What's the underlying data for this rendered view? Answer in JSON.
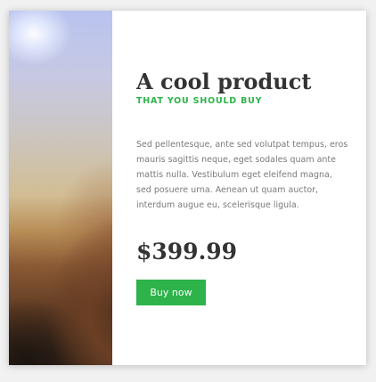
{
  "product": {
    "title": "A cool product",
    "tagline": "THAT YOU SHOULD BUY",
    "description": "Sed pellentesque, ante sed volutpat tempus, eros mauris sagittis neque, eget sodales quam ante mattis nulla. Vestibulum eget eleifend magna, sed posuere urna. Aenean ut quam auctor, interdum augue eu, scelerisque ligula.",
    "price": "$399.99",
    "buy_label": "Buy now"
  },
  "colors": {
    "accent": "#2db34a",
    "title": "#333333",
    "body_text": "#7a7a7a",
    "card": "#ffffff",
    "page_background": "#f1f1f1"
  }
}
